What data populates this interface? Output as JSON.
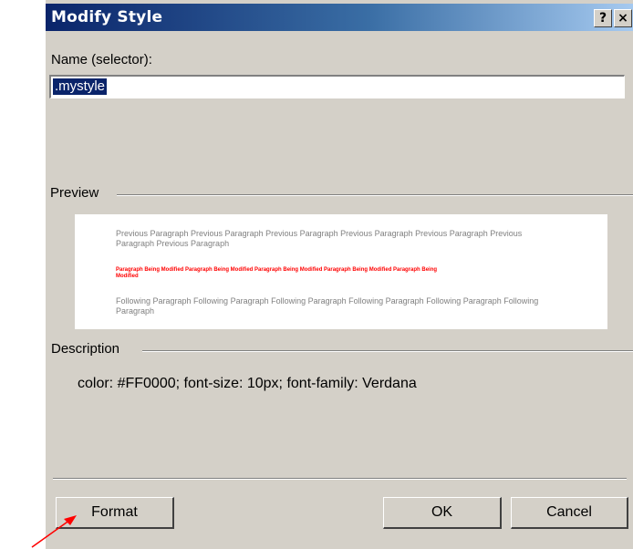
{
  "dialog": {
    "title": "Modify Style",
    "help_button": "?",
    "close_button": "×"
  },
  "name_section": {
    "label": "Name (selector):",
    "value": ".mystyle"
  },
  "preview_section": {
    "label": "Preview",
    "previous_paragraph": "Previous Paragraph Previous Paragraph Previous Paragraph Previous Paragraph Previous Paragraph Previous Paragraph Previous Paragraph",
    "sample_paragraph": "Paragraph Being Modified Paragraph Being Modified Paragraph Being Modified Paragraph Being Modified Paragraph Being Modified",
    "following_paragraph": "Following Paragraph Following Paragraph Following Paragraph Following Paragraph Following Paragraph Following Paragraph"
  },
  "description_section": {
    "label": "Description",
    "text": "color: #FF0000; font-size: 10px; font-family: Verdana"
  },
  "buttons": {
    "format": "Format",
    "ok": "OK",
    "cancel": "Cancel"
  },
  "colors": {
    "titlebar_start": "#0a246a",
    "titlebar_end": "#a6caf0",
    "dialog_bg": "#d4d0c8",
    "selection": "#0a246a",
    "preview_highlight": "#ff0000",
    "annotation_arrow": "#ff0000"
  }
}
